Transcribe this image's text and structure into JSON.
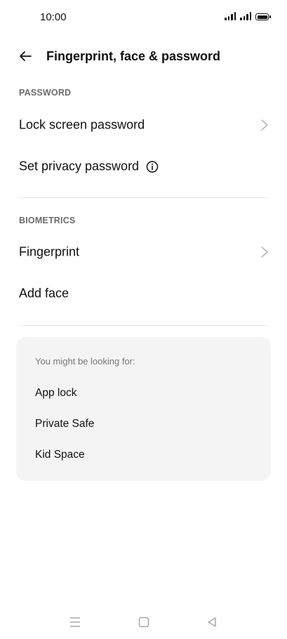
{
  "status_bar": {
    "time": "10:00",
    "icons": [
      "signal-icon",
      "signal-icon",
      "battery-icon"
    ]
  },
  "header": {
    "back_icon": "arrow-left-icon",
    "title": "Fingerprint, face & password"
  },
  "password_section": {
    "heading": "PASSWORD",
    "items": [
      {
        "label": "Lock screen password",
        "icon": "chevron-right-icon"
      },
      {
        "label": "Set privacy password",
        "icon": "info-icon"
      }
    ]
  },
  "biometrics_section": {
    "heading": "BIOMETRICS",
    "items": [
      {
        "label": "Fingerprint",
        "icon": "chevron-right-icon"
      },
      {
        "label": "Add face"
      }
    ]
  },
  "suggestions": {
    "heading": "You might be looking for:",
    "items": [
      "App lock",
      "Private Safe",
      "Kid Space"
    ]
  },
  "nav_bar": {
    "icons": [
      "menu-icon",
      "home-icon",
      "back-triangle-icon"
    ]
  },
  "colors": {
    "background": "#ffffff",
    "text": "#111111",
    "muted": "#6b6b6b",
    "card": "#f4f4f4",
    "divider": "#e6e6e6"
  }
}
